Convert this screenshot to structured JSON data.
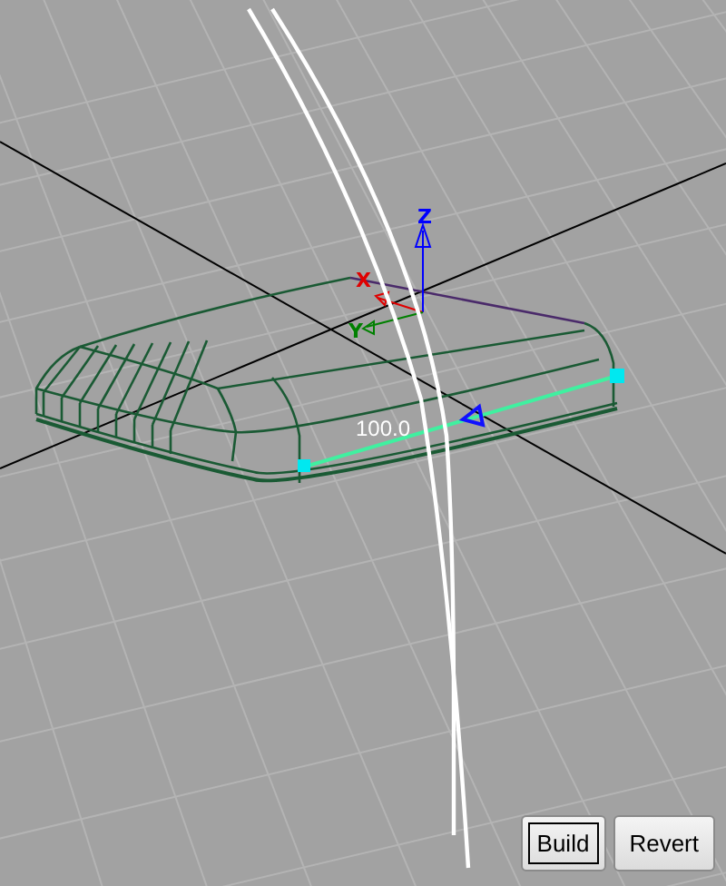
{
  "viewport": {
    "axes": [
      {
        "kind": "z",
        "label": "Z"
      },
      {
        "kind": "x",
        "label": "X"
      },
      {
        "kind": "y",
        "label": "Y"
      }
    ],
    "dimension": "100.0"
  },
  "buttons": [
    {
      "label": "Build",
      "focused": true
    },
    {
      "label": "Revert",
      "focused": false
    }
  ]
}
